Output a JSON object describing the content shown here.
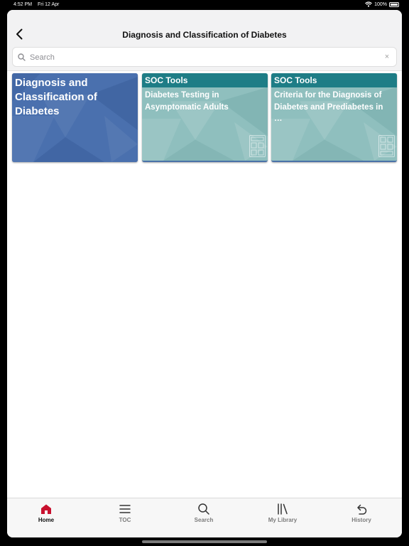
{
  "status": {
    "time": "4:52 PM",
    "date": "Fri 12 Apr",
    "battery": "100%"
  },
  "nav": {
    "title": "Diagnosis and Classification of Diabetes"
  },
  "search": {
    "placeholder": "Search",
    "clear_glyph": "×"
  },
  "cards": [
    {
      "title": "Diagnosis and Classification of Diabetes"
    },
    {
      "header": "SOC Tools",
      "title": "Diabetes Testing in Asymptomatic Adults"
    },
    {
      "header": "SOC Tools",
      "title": "Criteria for the Diagnosis of Diabetes and Prediabetes in …"
    }
  ],
  "tabs": [
    {
      "label": "Home",
      "icon": "home-icon",
      "active": true
    },
    {
      "label": "TOC",
      "icon": "list-icon"
    },
    {
      "label": "Search",
      "icon": "search-icon"
    },
    {
      "label": "My Library",
      "icon": "library-icon"
    },
    {
      "label": "History",
      "icon": "history-icon"
    }
  ],
  "colors": {
    "accent": "#c8102e",
    "card_blue": "#4a70ae",
    "card_teal": "#8fbfbe",
    "tool_header": "#1e7d86"
  }
}
